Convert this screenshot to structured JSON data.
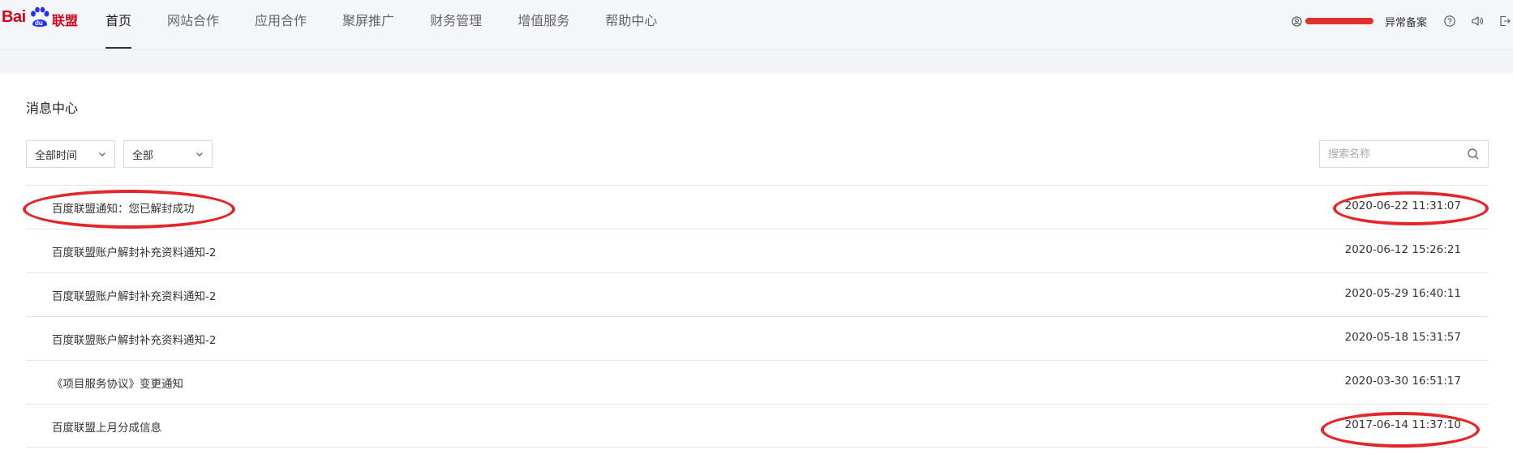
{
  "brand": {
    "logo_text": "Bai",
    "logo_text_2": "du",
    "logo_cn": "联盟"
  },
  "nav": {
    "items": [
      {
        "label": "首页",
        "active": true
      },
      {
        "label": "网站合作",
        "active": false
      },
      {
        "label": "应用合作",
        "active": false
      },
      {
        "label": "聚屏推广",
        "active": false
      },
      {
        "label": "财务管理",
        "active": false
      },
      {
        "label": "增值服务",
        "active": false
      },
      {
        "label": "帮助中心",
        "active": false
      }
    ]
  },
  "header": {
    "abnormal_filing": "异常备案",
    "icons": [
      "user-icon",
      "help-icon",
      "sound-icon",
      "logout-icon"
    ]
  },
  "page": {
    "title": "消息中心",
    "filters": {
      "time_value": "全部时间",
      "type_value": "全部"
    },
    "search": {
      "placeholder": "搜索名称"
    }
  },
  "messages": [
    {
      "title": "百度联盟通知：您已解封成功",
      "time": "2020-06-22 11:31:07"
    },
    {
      "title": "百度联盟账户解封补充资料通知-2",
      "time": "2020-06-12 15:26:21"
    },
    {
      "title": "百度联盟账户解封补充资料通知-2",
      "time": "2020-05-29 16:40:11"
    },
    {
      "title": "百度联盟账户解封补充资料通知-2",
      "time": "2020-05-18 15:31:57"
    },
    {
      "title": "《项目服务协议》变更通知",
      "time": "2020-03-30 16:51:17"
    },
    {
      "title": "百度联盟上月分成信息",
      "time": "2017-06-14 11:37:10"
    }
  ],
  "colors": {
    "brand_red": "#d0021b",
    "annotation_red": "#e2262a",
    "accent_blue": "#2932e1"
  }
}
